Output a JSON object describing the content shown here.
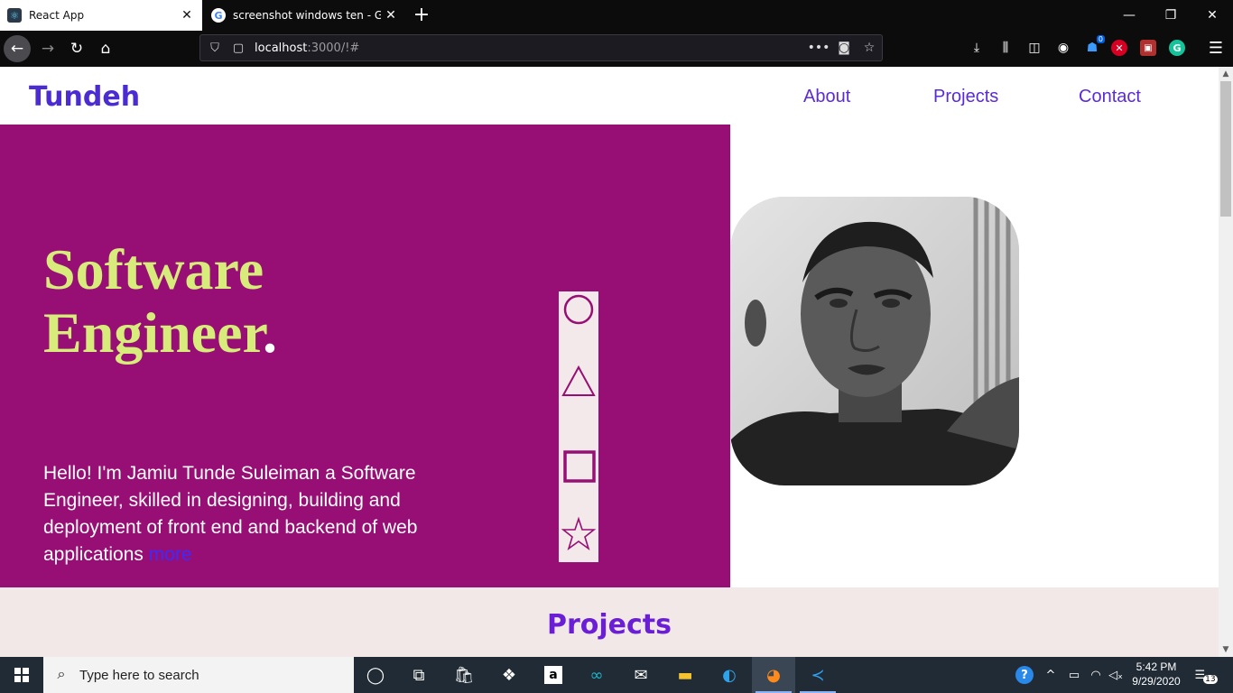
{
  "browser": {
    "tabs": [
      {
        "title": "React App",
        "active": true
      },
      {
        "title": "screenshot windows ten - Goo",
        "active": false
      }
    ],
    "new_tab_icon": "plus-icon",
    "url": {
      "host": "localhost",
      "path": ":3000/!#"
    },
    "window_controls": [
      "minimize-icon",
      "restore-icon",
      "close-icon"
    ],
    "extension_badge": "0"
  },
  "site": {
    "brand": "Tundeh",
    "nav": [
      {
        "label": "About"
      },
      {
        "label": "Projects"
      },
      {
        "label": "Contact"
      }
    ],
    "hero": {
      "title_line1": "Software",
      "title_line2": "Engineer",
      "title_dot": ".",
      "intro": "Hello! I'm Jamiu Tunde Suleiman a Software Engineer, skilled in designing, building and deployment of front end and backend of web applications",
      "more_link": "more"
    },
    "shapes": [
      "circle-icon",
      "triangle-icon",
      "square-icon",
      "star-icon"
    ],
    "projects_heading": "Projects",
    "colors": {
      "hero_bg": "#970f74",
      "title": "#d7ec7a",
      "brand": "#4b2bd2",
      "nav": "#5a2bd6",
      "projects_bg": "#f3e8e8",
      "projects_heading": "#6a1fd6"
    }
  },
  "taskbar": {
    "search_placeholder": "Type here to search",
    "time": "5:42 PM",
    "date": "9/29/2020",
    "notifications": "13"
  }
}
